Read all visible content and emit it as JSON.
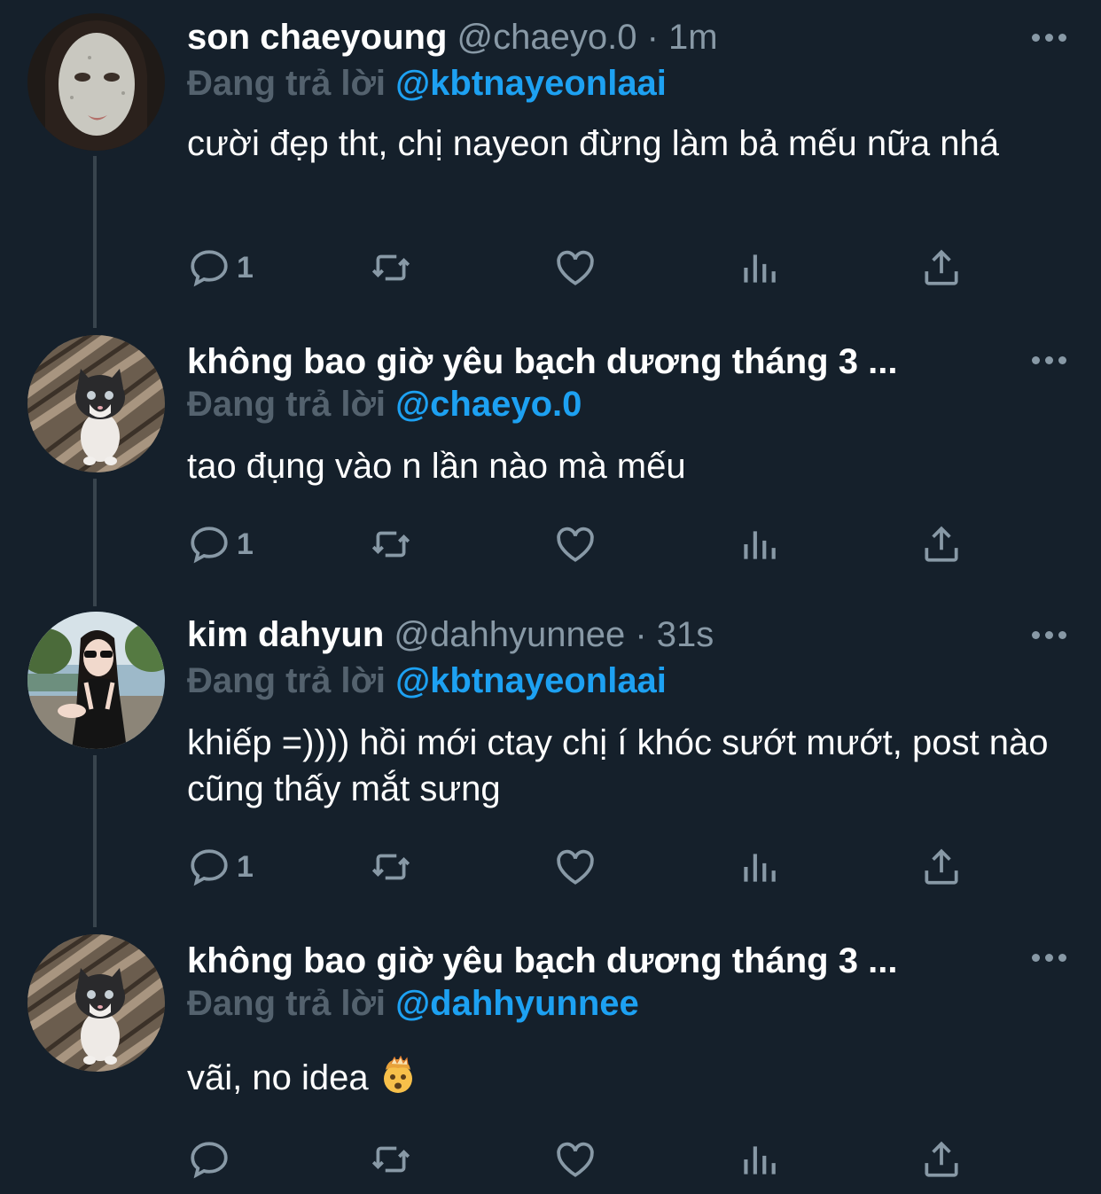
{
  "colors": {
    "background": "#15202b",
    "muted": "#8899a6",
    "link": "#1da1f2",
    "thread_line": "#38444d"
  },
  "tweets": [
    {
      "display_name": "son chaeyoung",
      "handle": "@chaeyo.0",
      "separator": "·",
      "time": "1m",
      "reply_prefix": "Đang trả lời",
      "reply_target": "@kbtnayeonlaai",
      "text": "cười đẹp tht, chị nayeon đừng làm bả mếu nữa nhá",
      "reply_count": "1",
      "avatar": "face-mask-avatar"
    },
    {
      "display_name": "không bao giờ yêu bạch dương tháng 3 ...",
      "handle": "",
      "separator": "",
      "time": "",
      "reply_prefix": "Đang trả lời",
      "reply_target": "@chaeyo.0",
      "text": "tao đụng vào n lần nào mà mếu",
      "reply_count": "1",
      "avatar": "kitten-avatar"
    },
    {
      "display_name": "kim dahyun",
      "handle": "@dahhyunnee",
      "separator": "·",
      "time": "31s",
      "reply_prefix": "Đang trả lời",
      "reply_target": "@kbtnayeonlaai",
      "text": "khiếp =)))) hồi mới ctay chị í khóc sướt mướt, post nào cũng thấy mắt sưng",
      "reply_count": "1",
      "avatar": "girl-sunglasses-avatar"
    },
    {
      "display_name": "không bao giờ yêu bạch dương tháng 3 ...",
      "handle": "",
      "separator": "",
      "time": "",
      "reply_prefix": "Đang trả lời",
      "reply_target": "@dahhyunnee",
      "text": "vãi, no idea",
      "emoji": "exploding-head-emoji",
      "reply_count": "",
      "avatar": "kitten-avatar"
    }
  ]
}
